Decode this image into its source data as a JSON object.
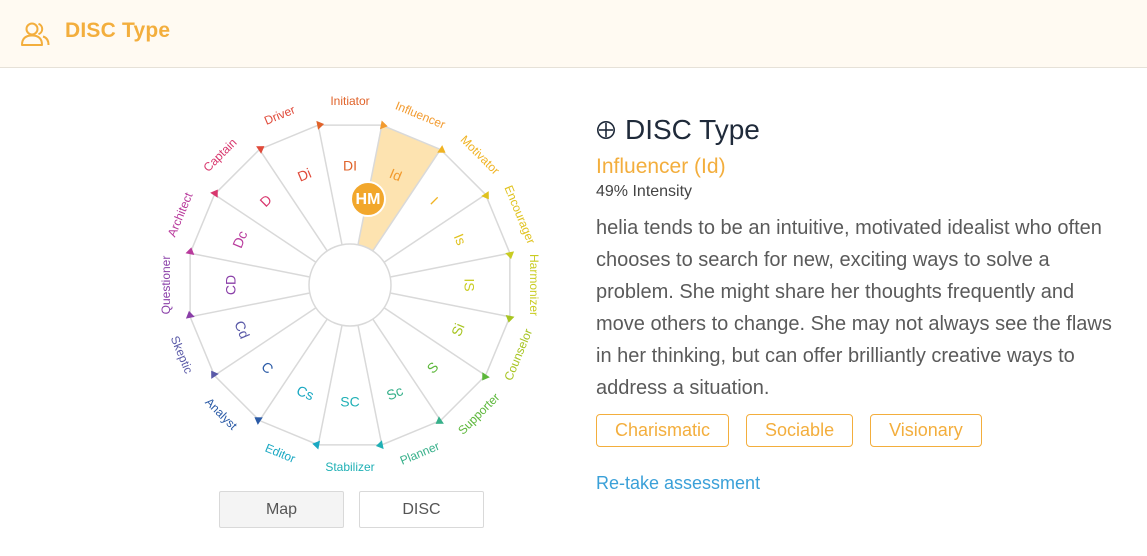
{
  "header": {
    "title": "DISC Type",
    "icon": "users-icon"
  },
  "wheel": {
    "segments": [
      {
        "label": "DI",
        "color": "#e0632a"
      },
      {
        "label": "Id",
        "color": "#f29a2e"
      },
      {
        "label": "I",
        "color": "#f0b323"
      },
      {
        "label": "Is",
        "color": "#e0c21e"
      },
      {
        "label": "IS",
        "color": "#c9cc22"
      },
      {
        "label": "Si",
        "color": "#a7c421"
      },
      {
        "label": "S",
        "color": "#5cb73a"
      },
      {
        "label": "Sc",
        "color": "#37b08a"
      },
      {
        "label": "SC",
        "color": "#1fb0b5"
      },
      {
        "label": "Cs",
        "color": "#1aa8c2"
      },
      {
        "label": "C",
        "color": "#2a5aa6"
      },
      {
        "label": "Cd",
        "color": "#5a5aa8"
      },
      {
        "label": "CD",
        "color": "#8a3fa8"
      },
      {
        "label": "Dc",
        "color": "#b83a9c"
      },
      {
        "label": "D",
        "color": "#d8366d"
      },
      {
        "label": "Di",
        "color": "#e04a3a"
      }
    ],
    "outer": [
      {
        "label": "Initiator",
        "color": "#e0632a"
      },
      {
        "label": "Influencer",
        "color": "#f29a2e"
      },
      {
        "label": "Motivator",
        "color": "#f0b323"
      },
      {
        "label": "Encourager",
        "color": "#e0c21e"
      },
      {
        "label": "Harmonizer",
        "color": "#c9cc22"
      },
      {
        "label": "Counselor",
        "color": "#a7c421"
      },
      {
        "label": "Supporter",
        "color": "#5cb73a"
      },
      {
        "label": "Planner",
        "color": "#37b08a"
      },
      {
        "label": "Stabilizer",
        "color": "#1fb0b5"
      },
      {
        "label": "Editor",
        "color": "#1aa8c2"
      },
      {
        "label": "Analyst",
        "color": "#2a5aa6"
      },
      {
        "label": "Skeptic",
        "color": "#5a5aa8"
      },
      {
        "label": "Questioner",
        "color": "#8a3fa8"
      },
      {
        "label": "Architect",
        "color": "#b83a9c"
      },
      {
        "label": "Captain",
        "color": "#d8366d"
      },
      {
        "label": "Driver",
        "color": "#e04a3a"
      }
    ],
    "highlight_index": 1,
    "highlight_color": "#fde3b0",
    "marker": {
      "initials": "HM",
      "color": "#f2a72c"
    }
  },
  "buttons": {
    "map": "Map",
    "disc": "DISC"
  },
  "info": {
    "heading": "DISC Type",
    "type": "Influencer (Id)",
    "intensity": "49% Intensity",
    "description": "helia tends to be an intuitive, motivated idealist who often chooses to search for new, exciting ways to solve a problem. She might share her thoughts frequently and move others to change. She may not always see the flaws in her thinking, but can offer brilliantly creative ways to address a situation.",
    "tags": [
      "Charismatic",
      "Sociable",
      "Visionary"
    ],
    "retake": "Re-take assessment"
  }
}
